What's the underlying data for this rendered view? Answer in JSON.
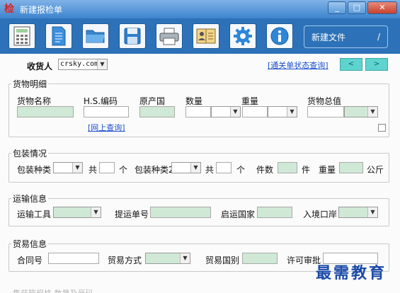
{
  "window": {
    "icon_glyph": "检",
    "title": "新建报检单",
    "minimize": "_",
    "maximize": "□",
    "close": "✕"
  },
  "toolbar": {
    "icons": [
      "calculator-icon",
      "document-icon",
      "open-folder-icon",
      "save-icon",
      "print-icon",
      "address-book-icon",
      "gear-icon",
      "info-icon"
    ],
    "newfile_label": "新建文件",
    "newfile_mark": "/"
  },
  "header": {
    "consignee_label": "收货人",
    "consignee_value": "crsky.com",
    "customs_link": "[通关单状态查询]",
    "prev": "<",
    "next": ">"
  },
  "goods": {
    "title": "货物明细",
    "name_label": "货物名称",
    "hs_label": "H.S.编码",
    "origin_label": "原产国",
    "qty_label": "数量",
    "weight_label": "重量",
    "total_label": "货物总值",
    "online_link": "[网上查询]"
  },
  "packing": {
    "title": "包装情况",
    "type_label": "包装种类",
    "total_label": "共",
    "unit": "个",
    "type2_label": "包装种类2",
    "total2_label": "共",
    "unit2": "个",
    "count_label": "件数",
    "count_unit": "件",
    "weight_label": "重量",
    "weight_unit": "公斤"
  },
  "transport": {
    "title": "运输信息",
    "tool_label": "运输工具",
    "bill_label": "提运单号",
    "depart_label": "启运国家",
    "port_label": "入境口岸"
  },
  "trade": {
    "title": "贸易信息",
    "contract_label": "合同号",
    "mode_label": "贸易方式",
    "country_label": "贸易国别",
    "license_label": "许可审批"
  },
  "footer_faded": "集装箱规格    数量及号码",
  "watermark": "最需教育"
}
